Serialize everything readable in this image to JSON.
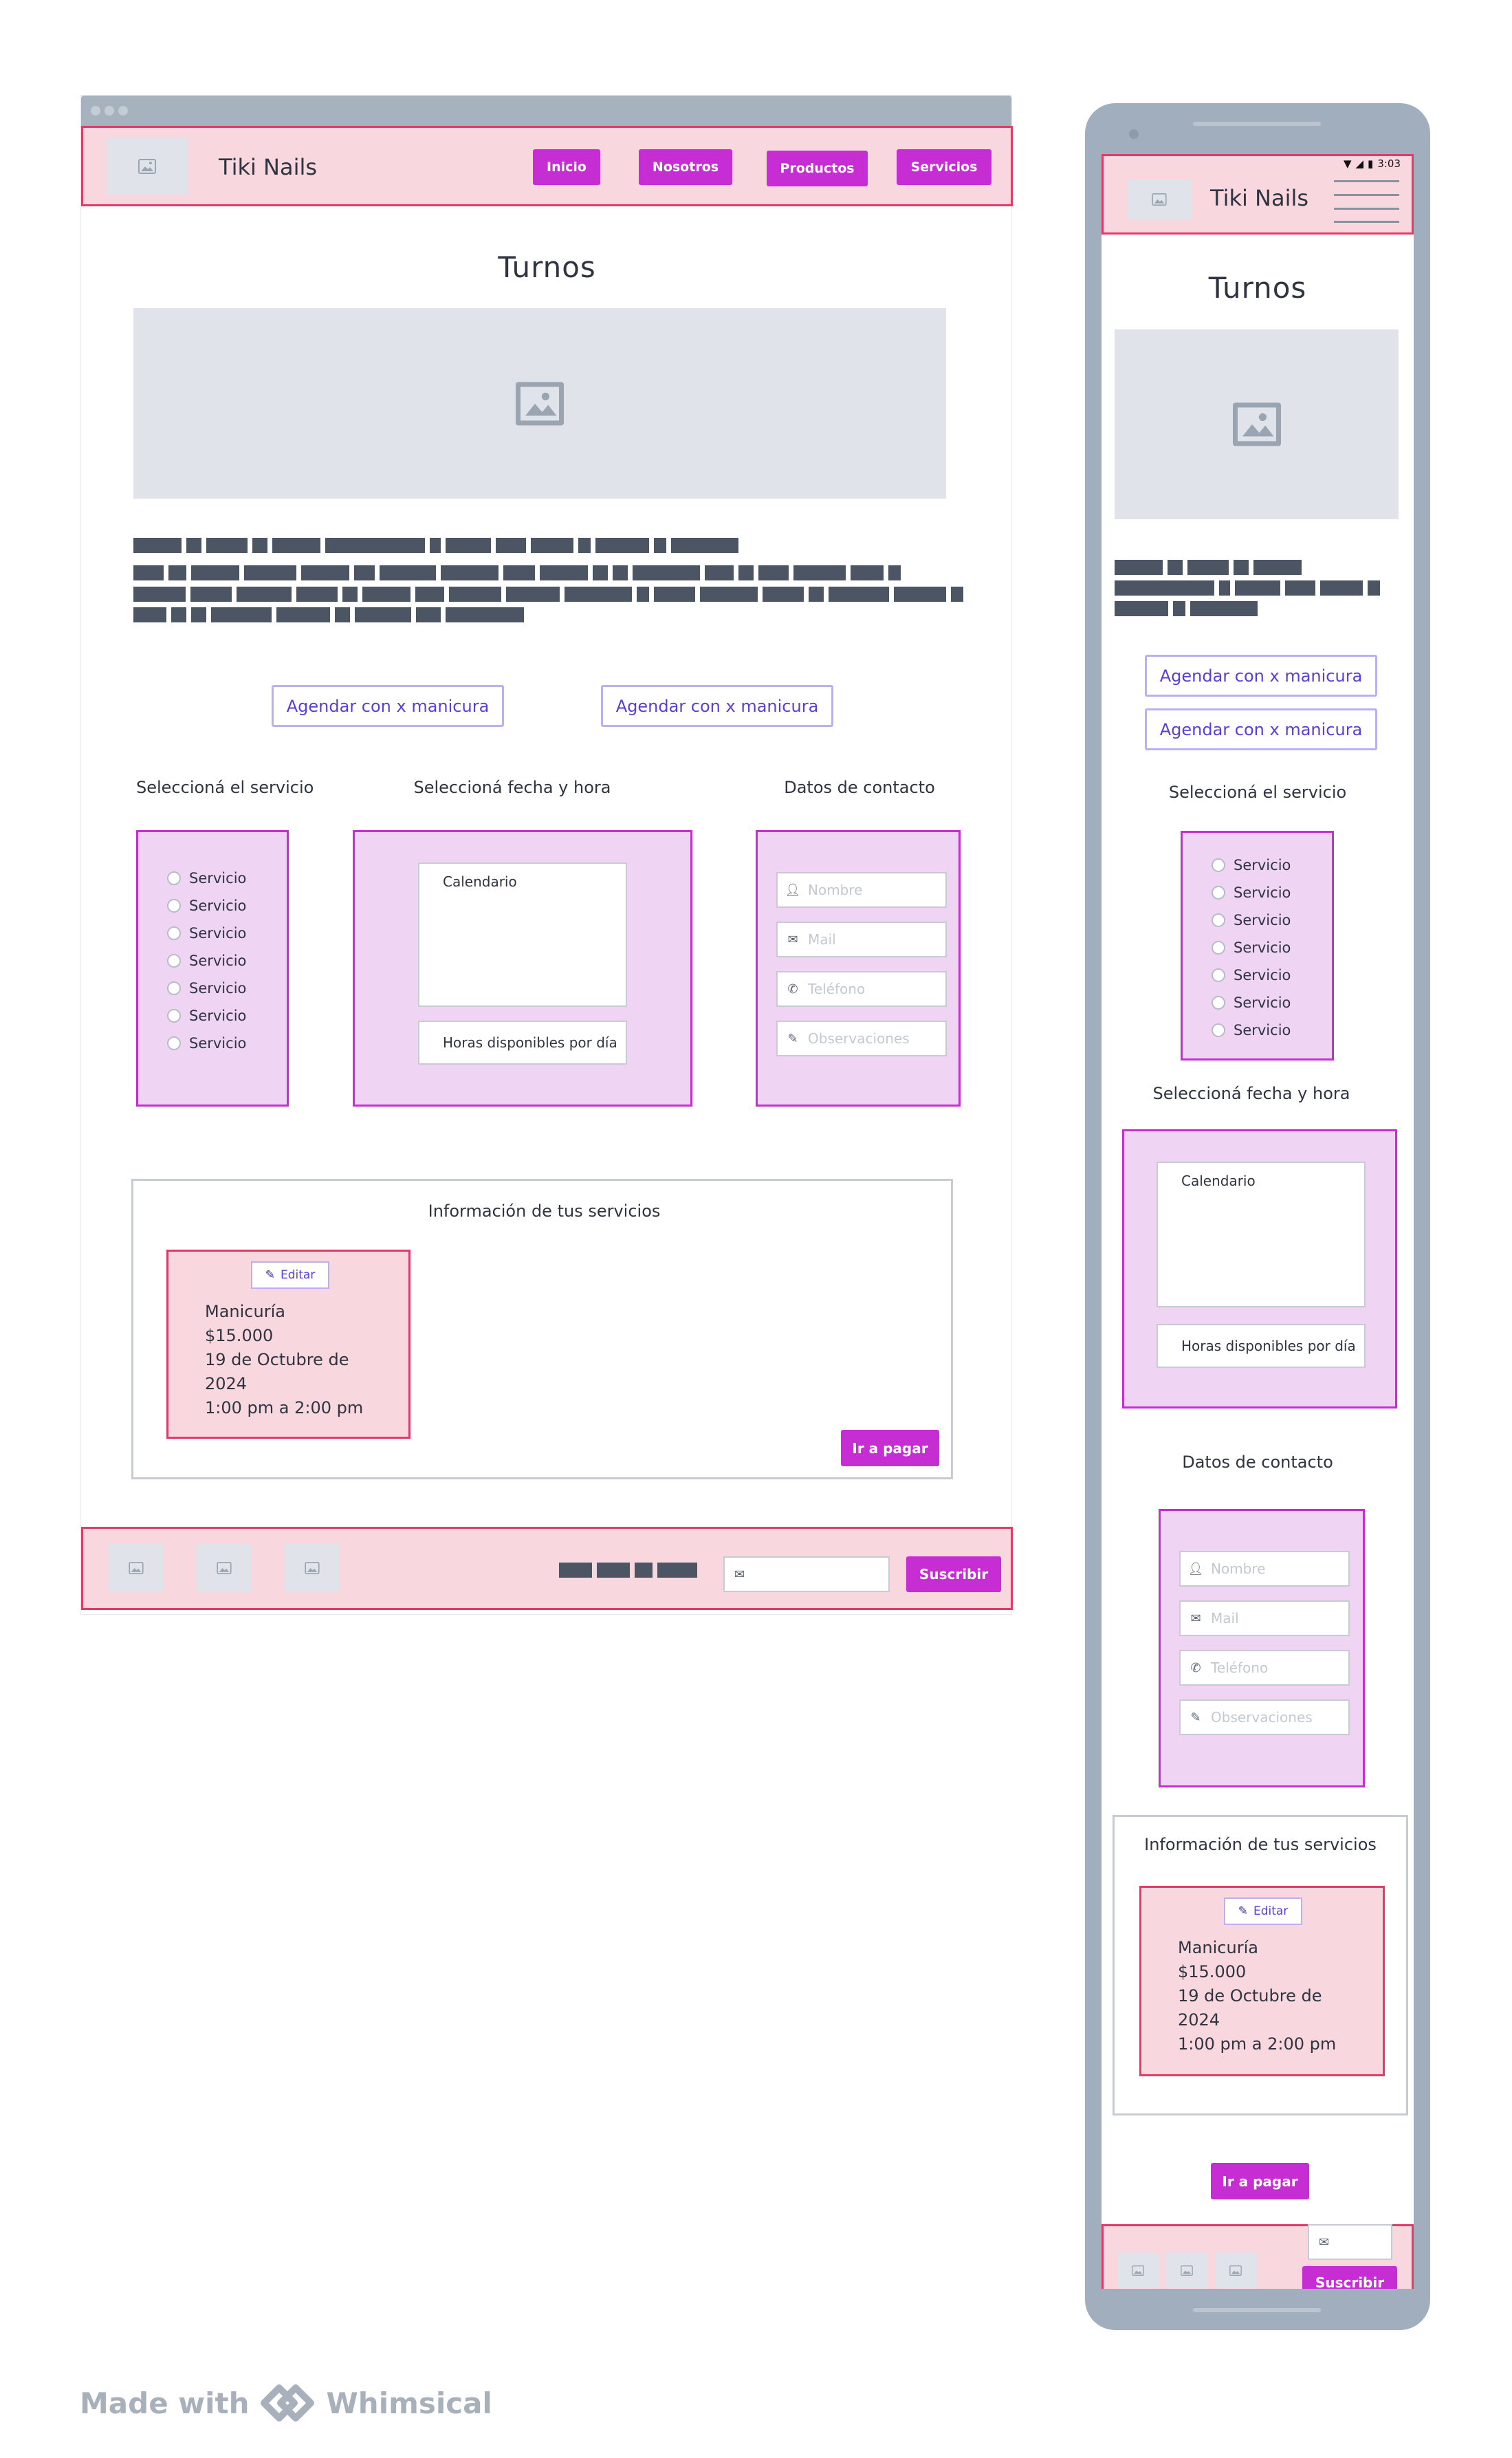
{
  "desktop": {
    "brand": "Tiki Nails",
    "nav": [
      "Inicio",
      "Nosotros",
      "Productos",
      "Servicios"
    ],
    "page_title": "Turnos",
    "book_buttons": [
      "Agendar con x manicura",
      "Agendar con x manicura"
    ],
    "section_service": "Seleccioná el servicio",
    "section_date": "Seleccioná fecha y hora",
    "section_contact": "Datos de contacto",
    "services": [
      "Servicio",
      "Servicio",
      "Servicio",
      "Servicio",
      "Servicio",
      "Servicio",
      "Servicio"
    ],
    "calendar_label": "Calendario",
    "hours_label": "Horas disponibles por día",
    "contact_fields": [
      {
        "icon": "user-icon",
        "placeholder": "Nombre"
      },
      {
        "icon": "mail-icon",
        "placeholder": "Mail"
      },
      {
        "icon": "phone-icon",
        "placeholder": "Teléfono"
      },
      {
        "icon": "pencil-icon",
        "placeholder": "Observaciones"
      }
    ],
    "info_title": "Información de tus servicios",
    "edit_label": "Editar",
    "summary": {
      "service": "Manicuría",
      "price": "$15.000",
      "date_line1": "19 de Octubre de",
      "date_line2": "2024",
      "time": "1:00 pm a 2:00 pm"
    },
    "pay_button": "Ir a pagar",
    "subscribe_button": "Suscribir"
  },
  "mobile": {
    "status_time": "3:03",
    "brand": "Tiki Nails",
    "page_title": "Turnos",
    "book_buttons": [
      "Agendar con x manicura",
      "Agendar con x manicura"
    ],
    "section_service": "Seleccioná el servicio",
    "services": [
      "Servicio",
      "Servicio",
      "Servicio",
      "Servicio",
      "Servicio",
      "Servicio",
      "Servicio"
    ],
    "section_date": "Seleccioná fecha y hora",
    "calendar_label": "Calendario",
    "hours_label": "Horas disponibles por día",
    "section_contact": "Datos de contacto",
    "contact_fields": [
      {
        "icon": "user-icon",
        "placeholder": "Nombre"
      },
      {
        "icon": "mail-icon",
        "placeholder": "Mail"
      },
      {
        "icon": "phone-icon",
        "placeholder": "Teléfono"
      },
      {
        "icon": "pencil-icon",
        "placeholder": "Observaciones"
      }
    ],
    "info_title": "Información de tus servicios",
    "edit_label": "Editar",
    "summary": {
      "service": "Manicuría",
      "price": "$15.000",
      "date_line1": "19 de Octubre de",
      "date_line2": "2024",
      "time": "1:00 pm a 2:00 pm"
    },
    "pay_button": "Ir a pagar",
    "subscribe_button": "Suscribir"
  },
  "made_with": "Made with",
  "whimsical": "Whimsical",
  "colors": {
    "accent": "#c62ed3",
    "pink_fill": "#f8d8de",
    "pink_border": "#e03c6a",
    "purple_fill": "#f0d4f4",
    "outline_button": "#5b3ed6",
    "placeholder": "#e0e4ea",
    "phone_frame": "#a0aebd"
  }
}
